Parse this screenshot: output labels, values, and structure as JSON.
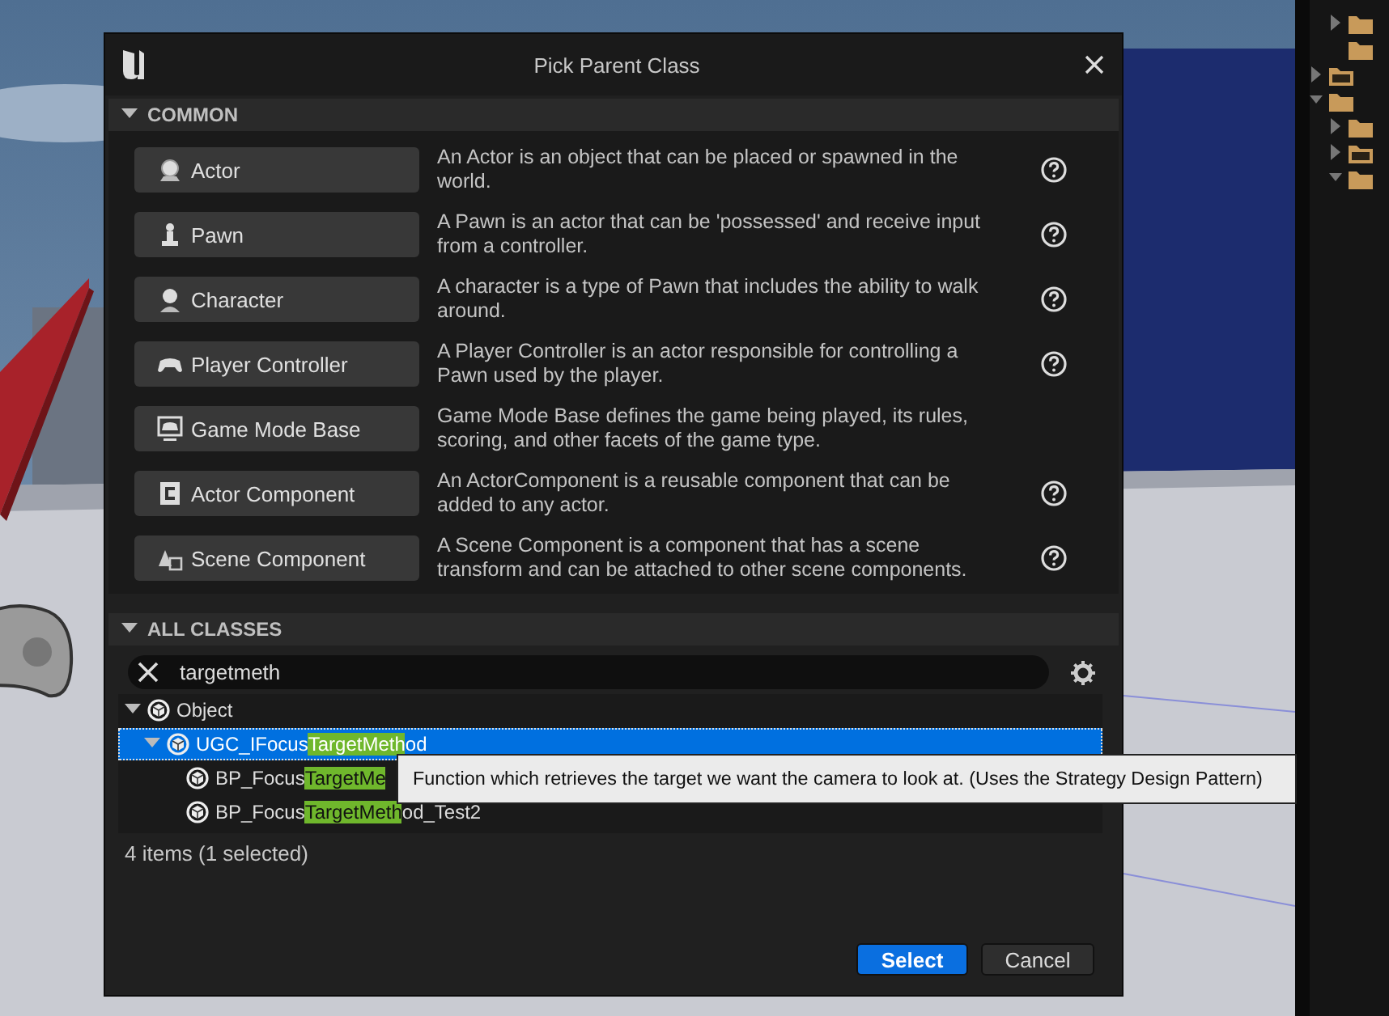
{
  "content_browser": {
    "tree": [
      {
        "children": [
          {
            "kind": "folder",
            "expanded": false,
            "selected": false
          },
          {
            "kind": "folder",
            "selected": false
          }
        ]
      },
      {
        "kind": "cpp_folder",
        "expanded": false,
        "selected": false
      },
      {
        "kind": "folder",
        "expanded": true,
        "selected": false,
        "children": [
          {
            "kind": "folder",
            "expanded": false,
            "selected": false
          },
          {
            "kind": "cpp_folder",
            "expanded": false,
            "selected": false
          },
          {
            "kind": "folder",
            "expanded": true,
            "selected": false
          }
        ]
      }
    ]
  },
  "dialog": {
    "title": "Pick Parent Class",
    "common": {
      "header": "COMMON",
      "expanded": true,
      "items": [
        {
          "kind": "actor",
          "label": "Actor",
          "description": "An Actor is an object that can be placed or spawned in the world.",
          "help": true
        },
        {
          "kind": "pawn",
          "label": "Pawn",
          "description": "A Pawn is an actor that can be 'possessed' and receive input from a controller.",
          "help": true
        },
        {
          "kind": "character",
          "label": "Character",
          "description": "A character is a type of Pawn that includes the ability to walk around.",
          "help": true
        },
        {
          "kind": "controller",
          "label": "Player Controller",
          "description": "A Player Controller is an actor responsible for controlling a Pawn used by the player.",
          "help": true
        },
        {
          "kind": "gamemode",
          "label": "Game Mode Base",
          "description": "Game Mode Base defines the game being played, its rules, scoring, and other facets of the game type.",
          "help": false
        },
        {
          "kind": "component",
          "label": "Actor Component",
          "description": "An ActorComponent is a reusable component that can be added to any actor.",
          "help": true
        },
        {
          "kind": "scene",
          "label": "Scene Component",
          "description": "A Scene Component is a component that has a scene transform and can be attached to other scene components.",
          "help": true
        }
      ]
    },
    "all_classes": {
      "header": "ALL CLASSES",
      "expanded": true,
      "search": {
        "value": "targetmeth"
      },
      "tree": [
        {
          "name_parts": [
            {
              "text": "Object",
              "match": false
            }
          ],
          "expanded": true,
          "selected": false,
          "children": [
            {
              "name_parts": [
                {
                  "text": "UGC_IFocus",
                  "match": false
                },
                {
                  "text": "TargetMeth",
                  "match": true
                },
                {
                  "text": "od",
                  "match": false
                }
              ],
              "expanded": true,
              "selected": true,
              "children": [
                {
                  "name_parts": [
                    {
                      "text": "BP_Focus",
                      "match": false
                    },
                    {
                      "text": "TargetMe",
                      "match": true
                    }
                  ],
                  "selected": false
                },
                {
                  "name_parts": [
                    {
                      "text": "BP_Focus",
                      "match": false
                    },
                    {
                      "text": "TargetMeth",
                      "match": true
                    },
                    {
                      "text": "od_Test2",
                      "match": false
                    }
                  ],
                  "selected": false
                }
              ]
            }
          ]
        }
      ],
      "status": "4 items (1 selected)"
    },
    "tooltip": "Function which retrieves the target we want the camera to look at. (Uses the Strategy Design Pattern)",
    "buttons": [
      {
        "label": "Select",
        "kind": "primary"
      },
      {
        "label": "Cancel",
        "kind": "secondary"
      }
    ]
  }
}
